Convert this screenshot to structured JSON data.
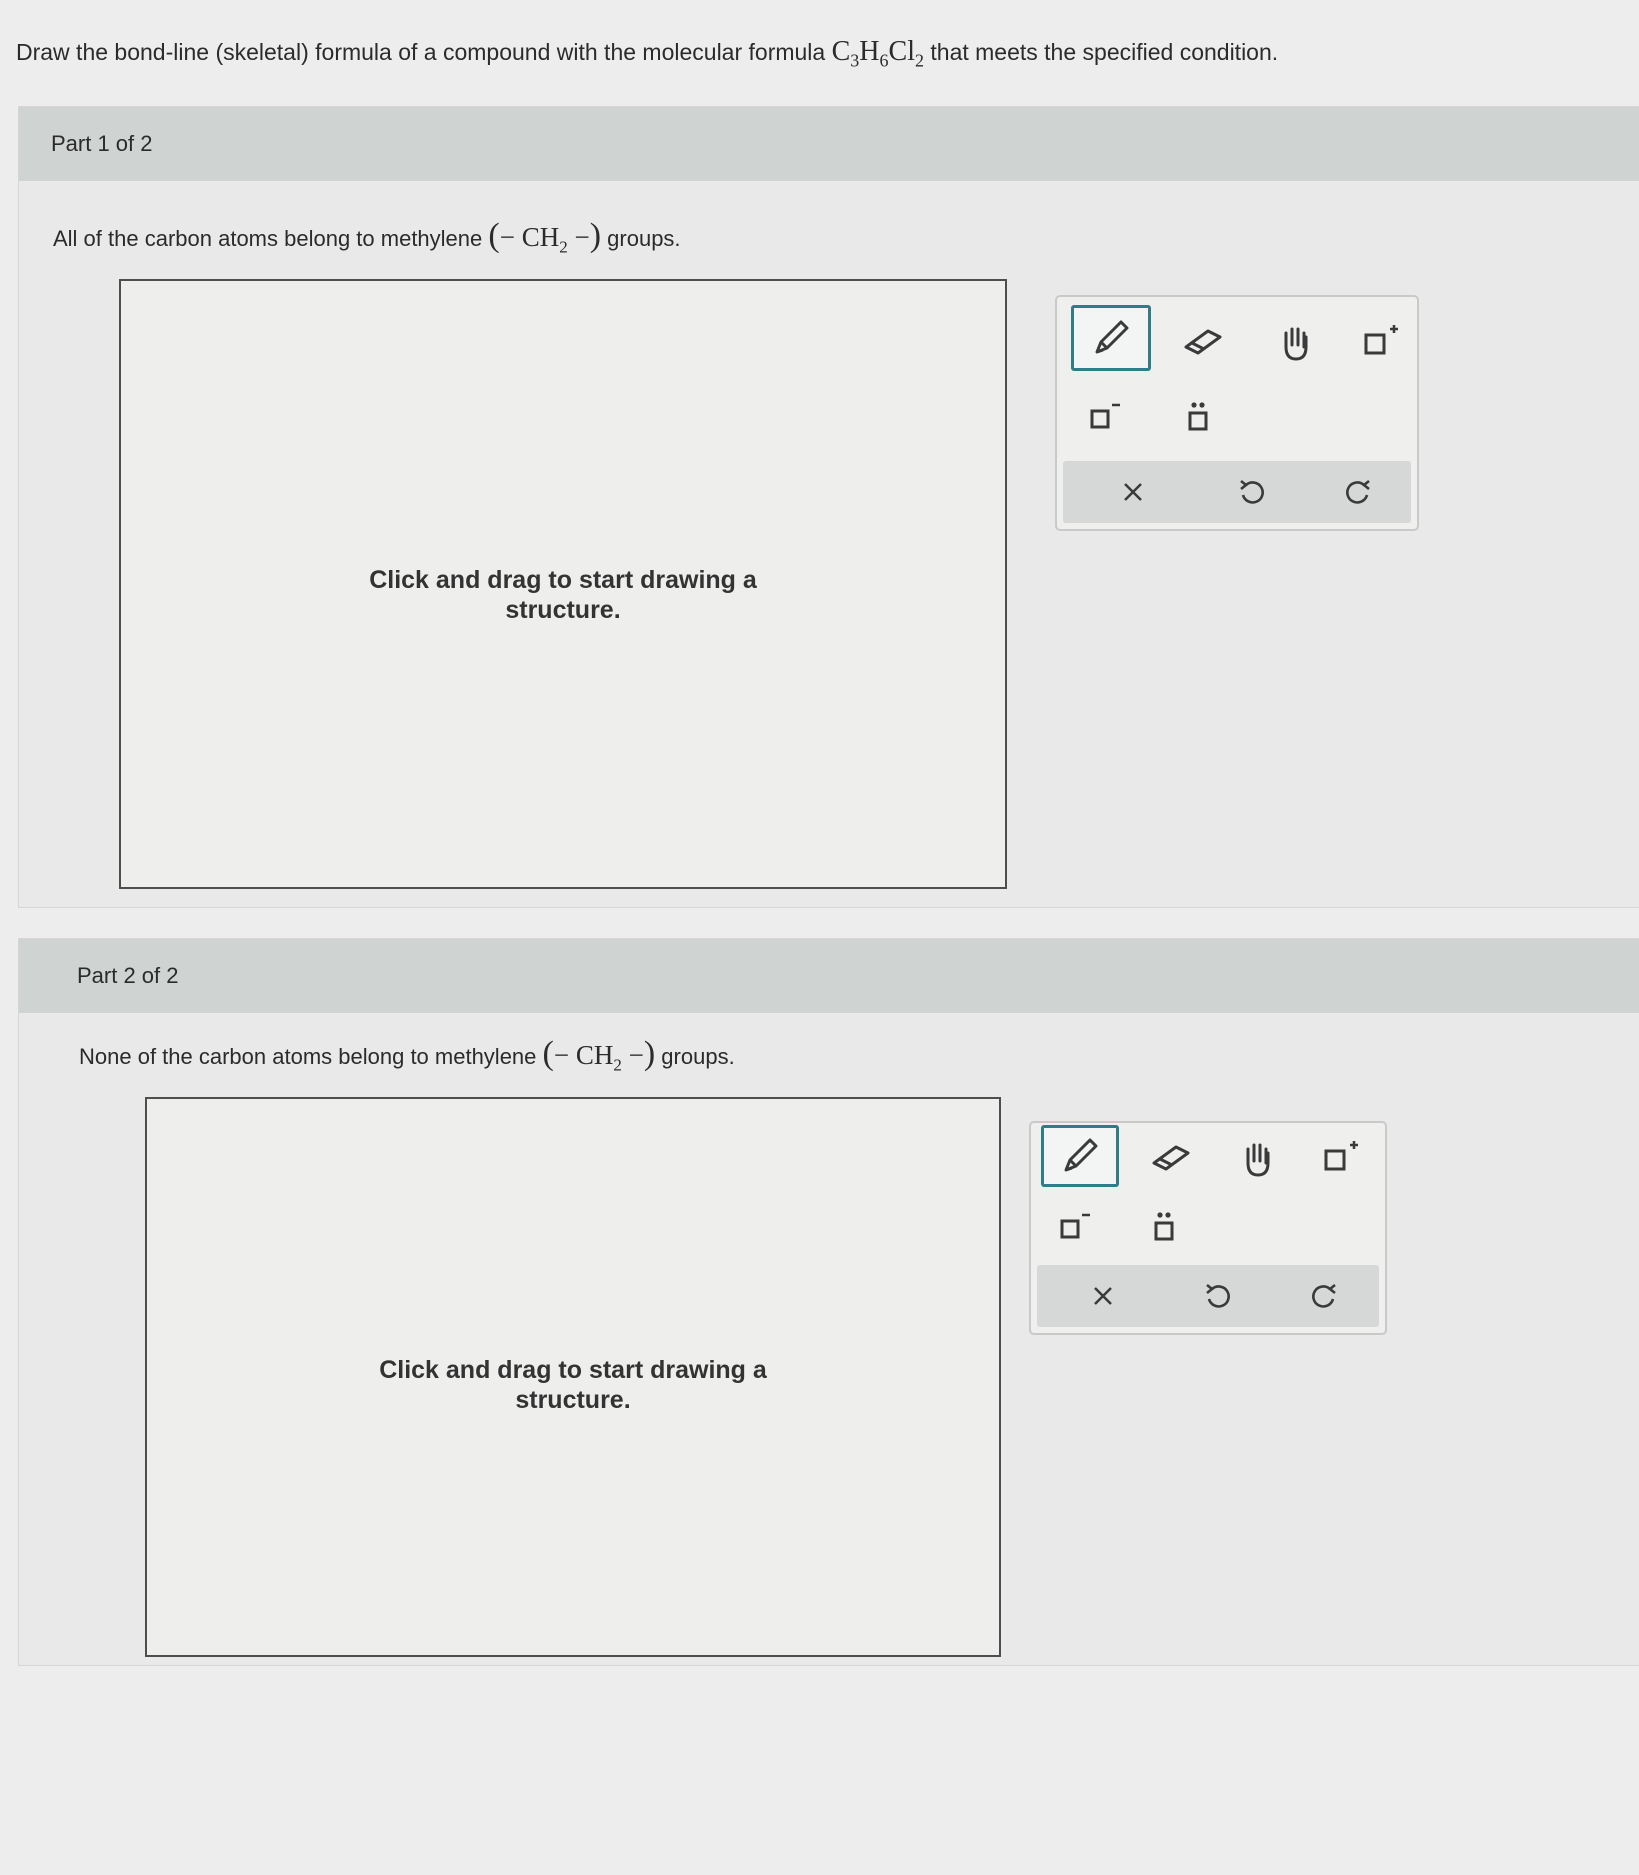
{
  "question": {
    "prefix": "Draw the bond-line (skeletal) formula of a compound with the molecular formula",
    "formula": {
      "c": "C",
      "c_sub": "3",
      "h": "H",
      "h_sub": "6",
      "cl": "Cl",
      "cl_sub": "2"
    },
    "suffix": "that meets the specified condition."
  },
  "parts": [
    {
      "label": "Part 1 of 2",
      "prompt_before": "All of the carbon atoms belong to methylene",
      "group": {
        "open": "(",
        "dash1": "−",
        "ch": "CH",
        "sub": "2",
        "dash2": "−",
        "close": ")"
      },
      "prompt_after": "groups.",
      "canvas_hint": [
        "Click and drag to start drawing a",
        "structure."
      ]
    },
    {
      "label": "Part 2 of 2",
      "prompt_before": "None of the carbon atoms belong to methylene",
      "group": {
        "open": "(",
        "dash1": "−",
        "ch": "CH",
        "sub": "2",
        "dash2": "−",
        "close": ")"
      },
      "prompt_after": "groups.",
      "canvas_hint": [
        "Click and drag to start drawing a",
        "structure."
      ]
    }
  ],
  "toolbar": {
    "tools": [
      "pencil-icon",
      "eraser-icon",
      "hand-icon",
      "add-charge-icon",
      "negative-charge-icon",
      "lone-pair-icon"
    ],
    "actions": [
      "clear-icon",
      "undo-icon",
      "redo-icon"
    ],
    "accent": "#2f7d89"
  }
}
